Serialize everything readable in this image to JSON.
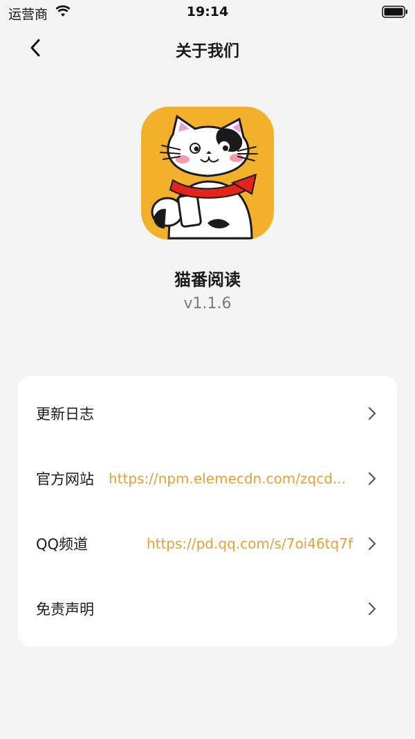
{
  "status_bar": {
    "carrier": "运营商",
    "time": "19:14"
  },
  "nav": {
    "title": "关于我们",
    "back_icon": "chevron-left-icon"
  },
  "app": {
    "name": "猫番阅读",
    "version": "v1.1.6",
    "logo_icon": "cat-reading-logo",
    "logo_bg": "#f3b02a"
  },
  "menu": {
    "items": [
      {
        "label": "更新日志",
        "value": ""
      },
      {
        "label": "官方网站",
        "value": "https://npm.elemecdn.com/zqcd..."
      },
      {
        "label": "QQ频道",
        "value": "https://pd.qq.com/s/7oi46tq7f"
      },
      {
        "label": "免责声明",
        "value": ""
      }
    ]
  },
  "colors": {
    "background": "#f4f4f4",
    "card": "#ffffff",
    "accent": "#e6a033",
    "secondary_text": "#7a7a7a"
  }
}
